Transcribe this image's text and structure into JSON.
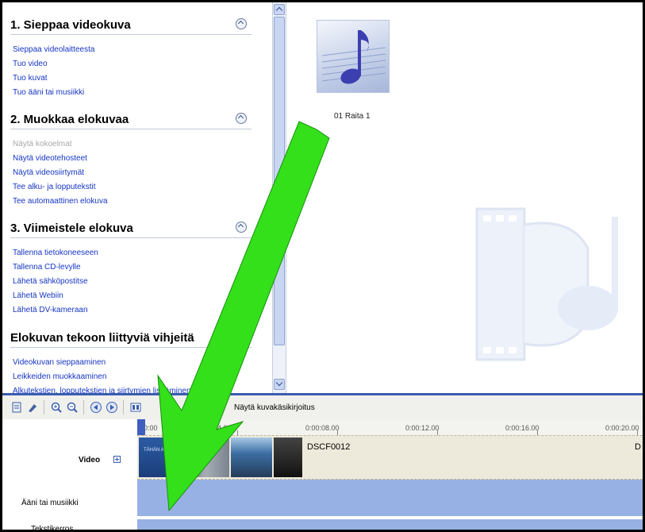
{
  "task_pane": {
    "sections": [
      {
        "title": "1. Sieppaa videokuva",
        "links": [
          {
            "label": "Sieppaa videolaitteesta",
            "enabled": true
          },
          {
            "label": "Tuo video",
            "enabled": true
          },
          {
            "label": "Tuo kuvat",
            "enabled": true
          },
          {
            "label": "Tuo ääni tai musiikki",
            "enabled": true
          }
        ]
      },
      {
        "title": "2. Muokkaa elokuvaa",
        "links": [
          {
            "label": "Näytä kokoelmat",
            "enabled": false
          },
          {
            "label": "Näytä videotehosteet",
            "enabled": true
          },
          {
            "label": "Näytä videosiirtymät",
            "enabled": true
          },
          {
            "label": "Tee alku- ja lopputekstit",
            "enabled": true
          },
          {
            "label": "Tee automaattinen elokuva",
            "enabled": true
          }
        ]
      },
      {
        "title": "3. Viimeistele elokuva",
        "links": [
          {
            "label": "Tallenna tietokoneeseen",
            "enabled": true
          },
          {
            "label": "Tallenna CD-levylle",
            "enabled": true
          },
          {
            "label": "Lähetä sähköpostitse",
            "enabled": true
          },
          {
            "label": "Lähetä Webiin",
            "enabled": true
          },
          {
            "label": "Lähetä DV-kameraan",
            "enabled": true
          }
        ]
      },
      {
        "title": "Elokuvan tekoon liittyviä vihjeitä",
        "links": [
          {
            "label": "Videokuvan sieppaaminen",
            "enabled": true
          },
          {
            "label": "Leikkeiden muokkaaminen",
            "enabled": true
          },
          {
            "label": "Alkutekstien, lopputekstien ja siirtymien lisääminen",
            "enabled": true
          }
        ]
      }
    ]
  },
  "collection": {
    "items": [
      {
        "caption": "01 Raita 1",
        "icon": "music-note-icon"
      }
    ]
  },
  "toolbar": {
    "timeline_label": "Näytä kuvakäsikirjoitus"
  },
  "timeline": {
    "ruler_ticks": [
      "0:00",
      "0:00:04.00",
      "0:00:08.00",
      "0:00:12.00",
      "0:00:16.00",
      "0:00:20.00"
    ],
    "tracks": {
      "video": "Video",
      "audio": "Ääni tai musiikki",
      "titles": "Tekstikerros"
    },
    "title_clip_text": "TÄHÄN ALKU",
    "clips": [
      "DSCF0012",
      "D"
    ]
  },
  "colors": {
    "annotation_arrow": "#33e01a",
    "accent": "#3b5cb0",
    "track_fill": "#98b1e4"
  }
}
